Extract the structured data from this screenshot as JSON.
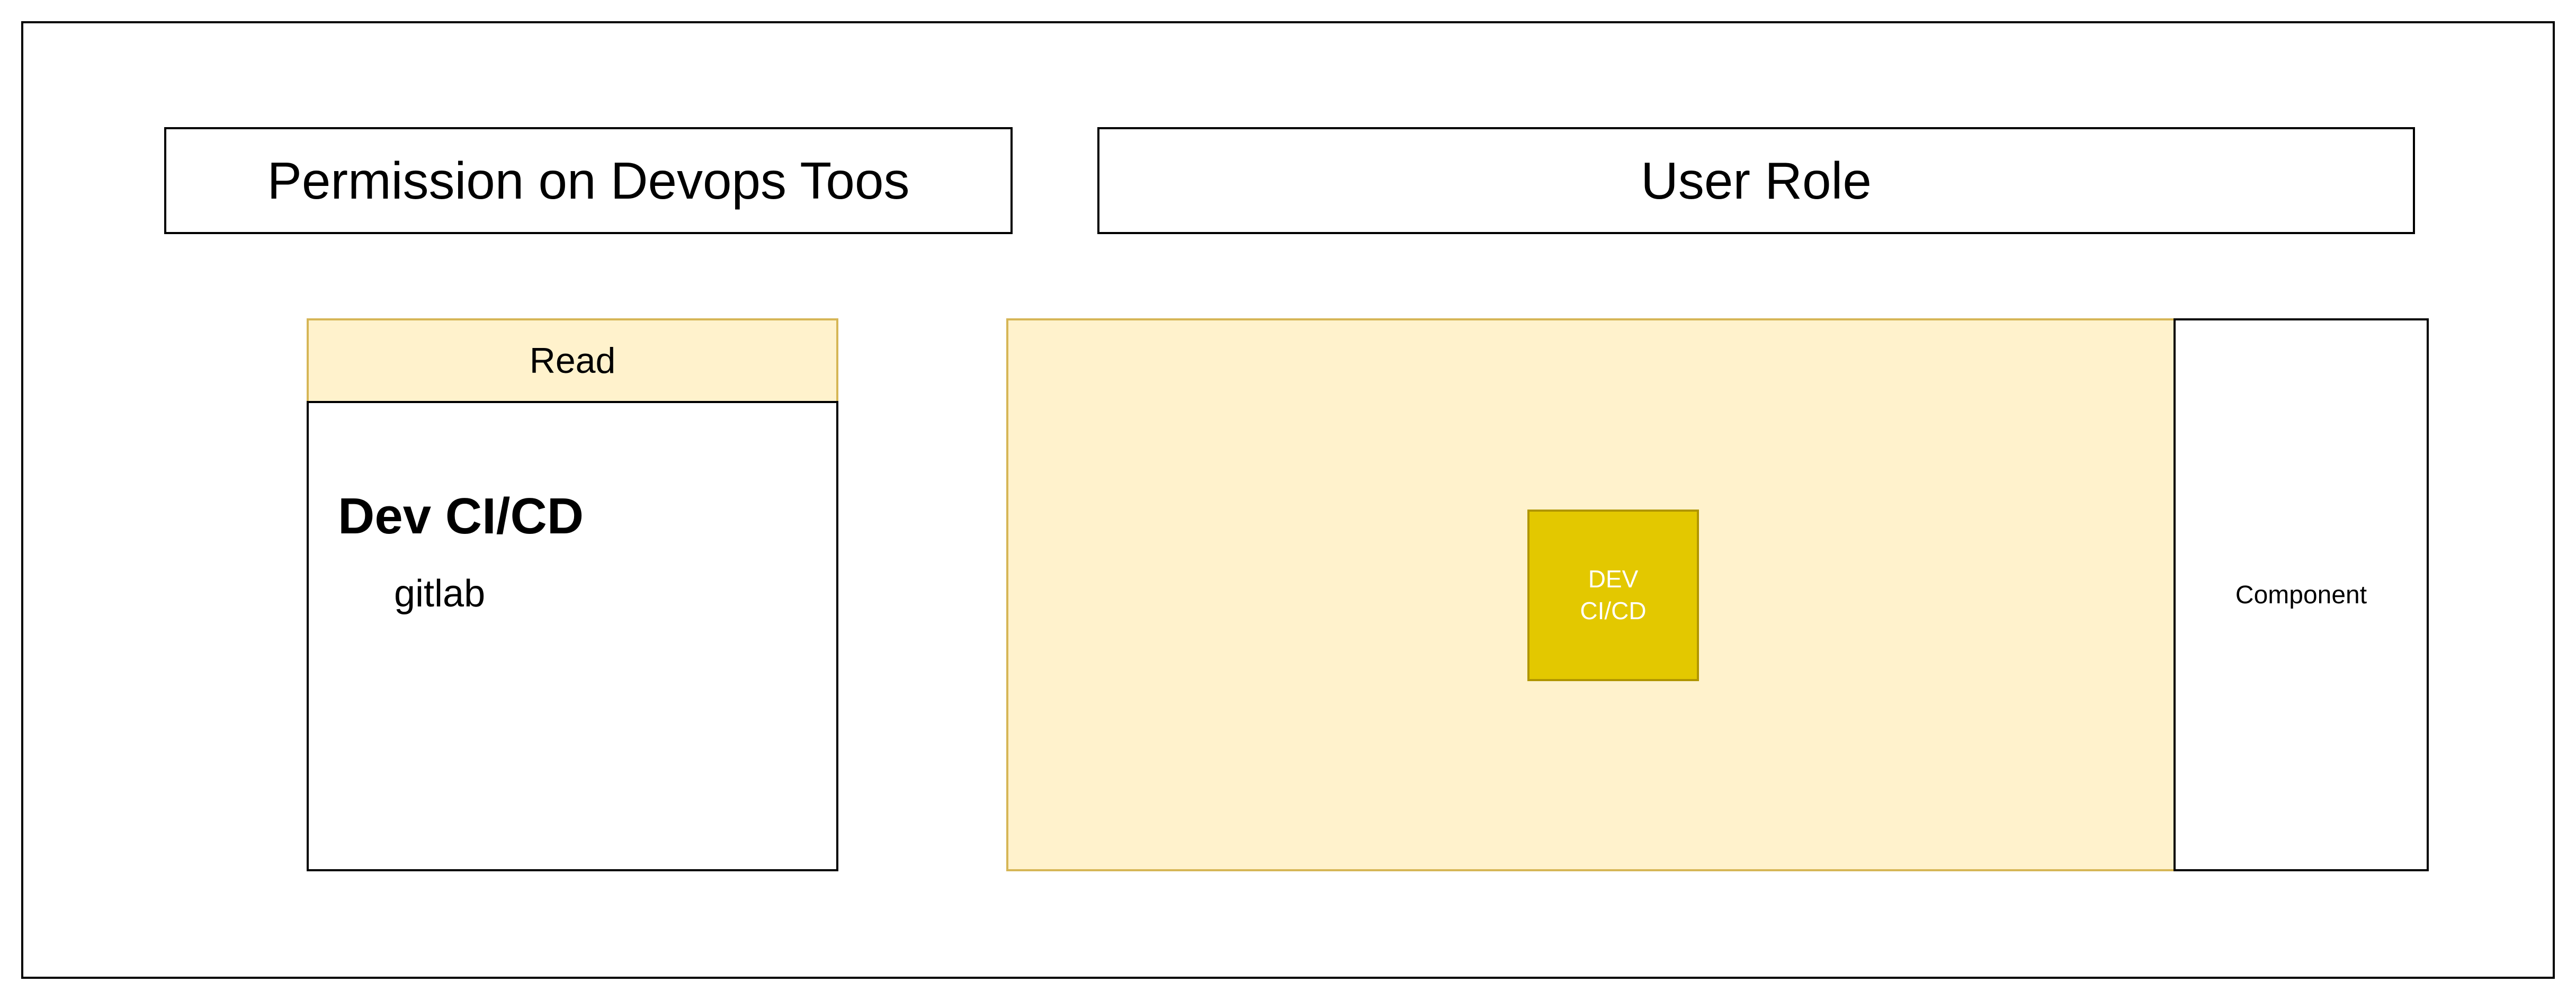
{
  "diagram": {
    "headers": {
      "permission": "Permission on Devops Toos",
      "user_role": "User Role"
    },
    "permission_panel": {
      "title": "Read",
      "heading": "Dev CI/CD",
      "tool": "gitlab"
    },
    "role_panel": {
      "node_label": "DEV\nCI/CD",
      "side_label": "Component"
    },
    "colors": {
      "panel_fill": "#fff2cc",
      "panel_stroke": "#d6b656",
      "node_fill": "#e3c800",
      "node_stroke": "#b09500",
      "line": "#000000"
    }
  }
}
